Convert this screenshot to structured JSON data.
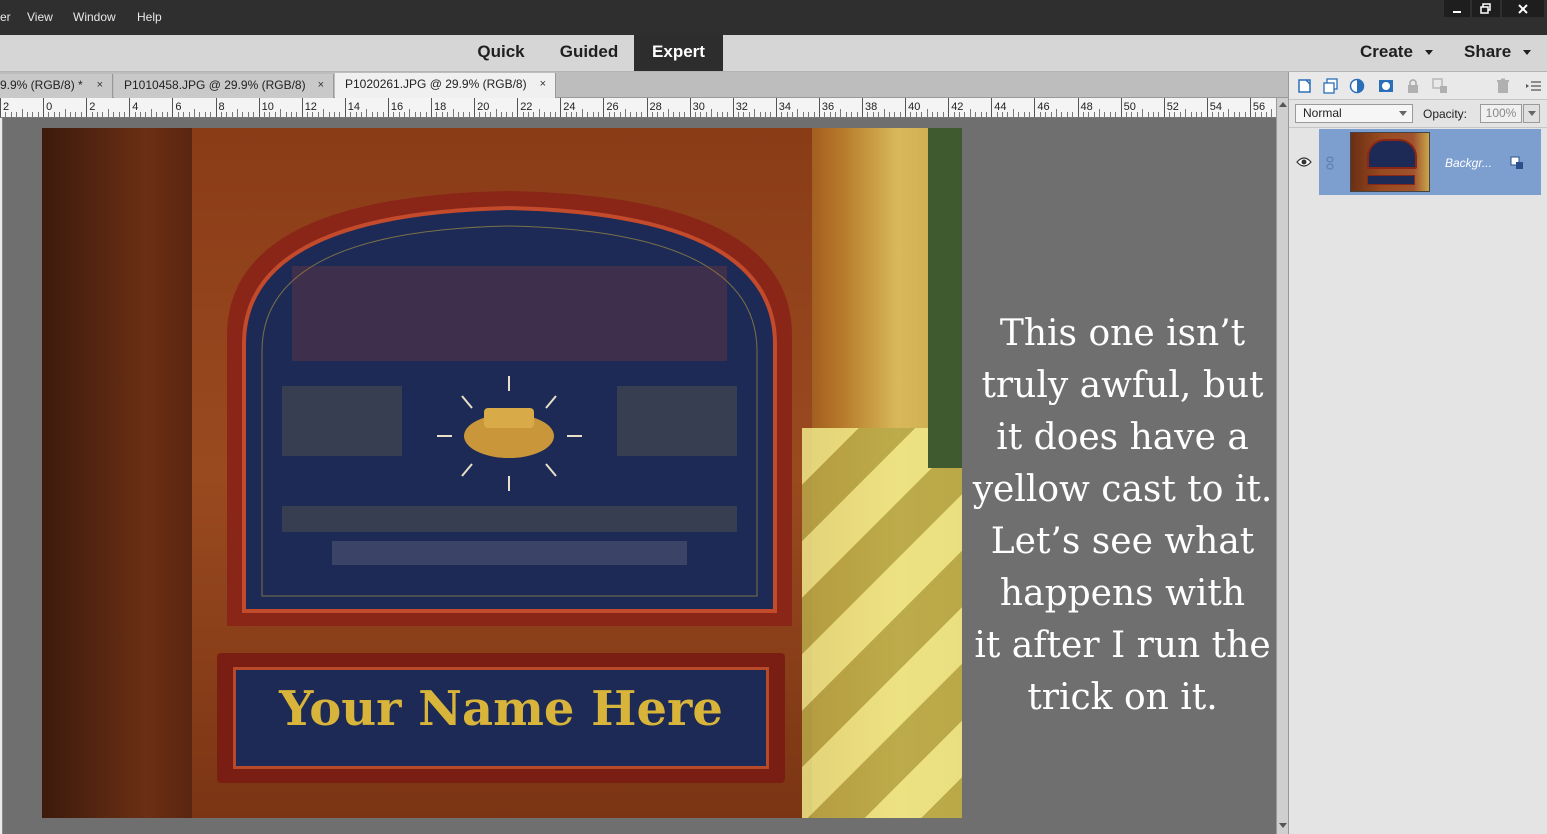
{
  "menubar": {
    "items": [
      "er",
      "View",
      "Window",
      "Help"
    ],
    "window_controls": [
      "minimize",
      "restore",
      "close"
    ]
  },
  "modes": {
    "items": [
      "Quick",
      "Guided",
      "Expert"
    ],
    "active": "Expert",
    "create_label": "Create",
    "share_label": "Share"
  },
  "tabs": [
    {
      "label": "9.9% (RGB/8) *",
      "close": "×"
    },
    {
      "label": "P1010458.JPG @ 29.9% (RGB/8)",
      "close": "×"
    },
    {
      "label": "P1020261.JPG @ 29.9% (RGB/8)",
      "close": "×"
    }
  ],
  "ruler": {
    "labels": [
      "2",
      "0",
      "2",
      "4",
      "6",
      "8",
      "10",
      "12",
      "14",
      "16",
      "18",
      "20",
      "22",
      "24",
      "26",
      "28",
      "30",
      "32",
      "34",
      "36",
      "38",
      "40",
      "42",
      "44",
      "46",
      "48",
      "50",
      "52",
      "54",
      "56"
    ]
  },
  "photo": {
    "nameplate_text": "Your Name Here"
  },
  "caption": {
    "lines": [
      "This one isn’t",
      "truly awful, but",
      "it does have a",
      "yellow cast to it.",
      "Let’s see what",
      "happens with",
      "it after I run the",
      "trick on it."
    ]
  },
  "layers_panel": {
    "blend_mode": "Normal",
    "opacity_label": "Opacity:",
    "opacity_value": "100%",
    "layers": [
      {
        "name": "Backgr...",
        "visible": true
      }
    ]
  },
  "icons": [
    "minimize-icon",
    "restore-icon",
    "close-icon",
    "new-layer-icon",
    "new-group-icon",
    "adjustment-layer-icon",
    "layer-mask-icon",
    "lock-icon",
    "lock-all-icon",
    "trash-icon",
    "panel-menu-icon",
    "eye-icon",
    "link-icon",
    "layer-badge-icon"
  ],
  "colors": {
    "menubar_bg": "#2f2f2f",
    "active_mode_bg": "#2d2d2d",
    "selected_layer": "#7d9fd0",
    "canvas_bg": "#6f6f6f"
  }
}
